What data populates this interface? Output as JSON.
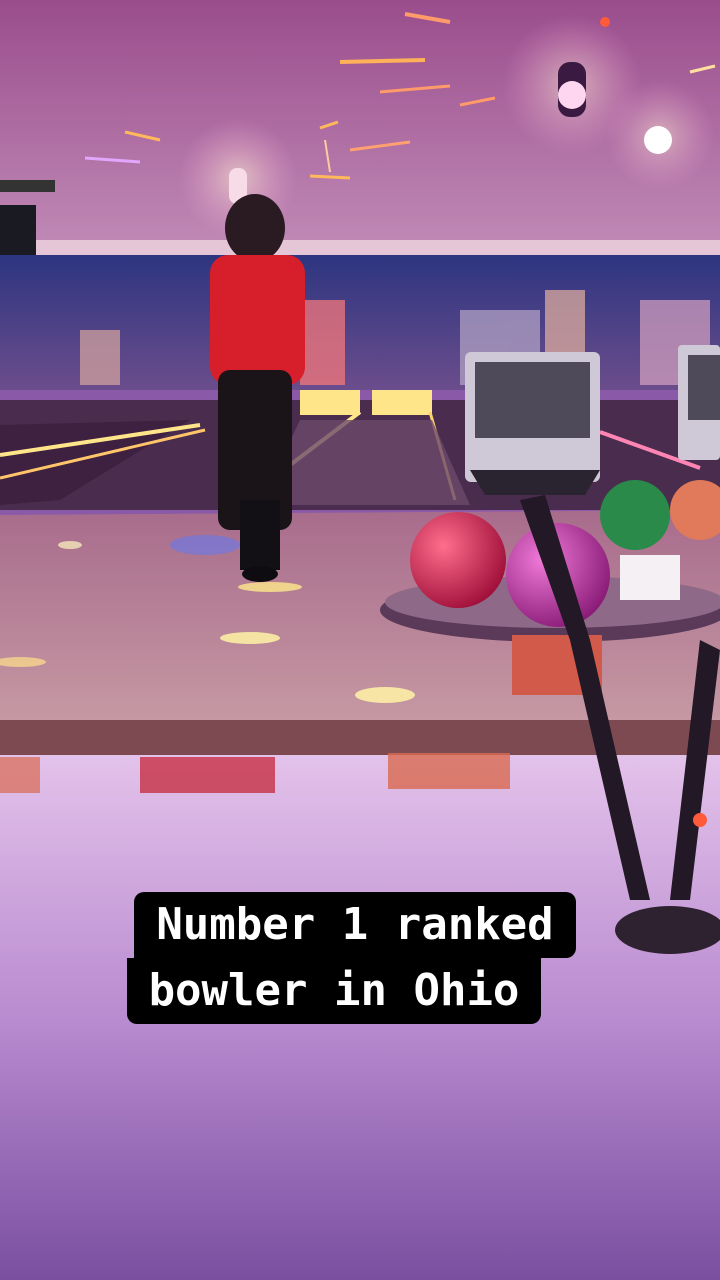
{
  "story": {
    "caption_lines": [
      "Number 1 ranked",
      "bowler in Ohio"
    ]
  },
  "colors": {
    "ceiling": "#a05a98",
    "wall_mural": "#3a3f86",
    "approach_floor": "#b88a98",
    "foreground_floor": "#d8b6e6",
    "shirt": "#d61f2a",
    "lane_glow": "#ffe58a",
    "caption_bg": "#000000",
    "caption_text": "#ffffff"
  },
  "objects": [
    "bowler",
    "bowling-lanes",
    "disco-lights",
    "ball-return",
    "bowling-balls",
    "score-monitor"
  ]
}
